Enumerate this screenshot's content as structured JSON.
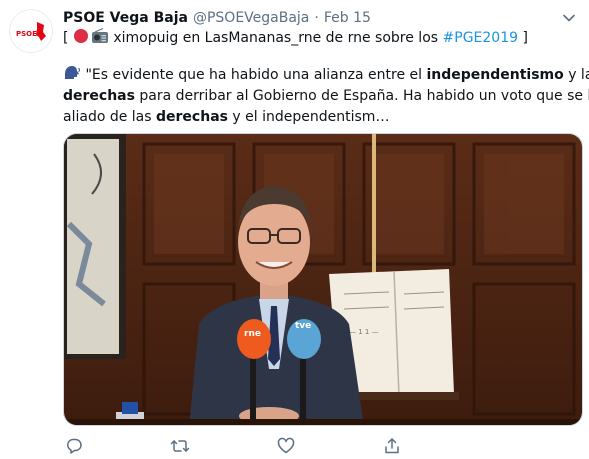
{
  "tweet": {
    "author_name": "PSOE Vega Baja",
    "author_handle": "@PSOEVegaBaja",
    "separator": "·",
    "date": "Feb 15",
    "avatar": {
      "logo_small_text": "VEGA BAJA",
      "logo_text": "PSOE"
    },
    "text": {
      "line1_open": "[ ",
      "line1_user": " ximopuig en LasMananas_rne de rne sobre los ",
      "line1_hashtag": "#PGE2019",
      "line1_close": " ]",
      "line2_a": " \"Es evidente que ha habido una alianza entre el ",
      "line2_b": "independentismo",
      "line2_c": " y las",
      "line3_a": "derechas",
      "line3_b": " para derribar al Gobierno de España. Ha habido un voto que se ha",
      "line4_a": "aliado de las ",
      "line4_b": "derechas",
      "line4_c": " y el independentism…"
    },
    "media": {
      "mic_left_label": "rne",
      "mic_right_label": "tve",
      "book_scribble": "— 1 1 —"
    },
    "icons": {
      "caret": "chevron-down-icon",
      "red_circle": "red-circle-emoji",
      "radio": "radio-emoji",
      "speaking_head": "speaking-head-emoji",
      "reply": "reply-icon",
      "retweet": "retweet-icon",
      "like": "like-icon",
      "share": "share-icon"
    },
    "colors": {
      "hashtag": "#1b95e0",
      "muted": "#5b7083",
      "icon": "#5b7083",
      "psoe_red": "#e30613"
    }
  }
}
